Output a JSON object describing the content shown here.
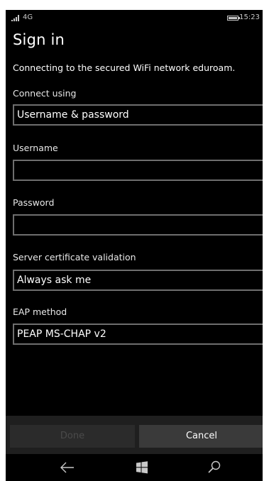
{
  "status_bar": {
    "network": "4G",
    "time": "15:23"
  },
  "page": {
    "title": "Sign in",
    "intro": "Connecting to the secured WiFi network eduroam."
  },
  "fields": {
    "connect_using": {
      "label": "Connect using",
      "value": "Username & password"
    },
    "username": {
      "label": "Username",
      "value": "",
      "placeholder": ""
    },
    "password": {
      "label": "Password",
      "value": "",
      "placeholder": ""
    },
    "server_cert": {
      "label": "Server certificate validation",
      "value": "Always ask me"
    },
    "eap_method": {
      "label": "EAP method",
      "value": "PEAP MS-CHAP v2"
    }
  },
  "app_bar": {
    "done_label": "Done",
    "cancel_label": "Cancel",
    "done_enabled": false
  },
  "nav_bar": {
    "back_icon": "back-arrow-icon",
    "start_icon": "windows-logo-icon",
    "search_icon": "search-icon"
  },
  "colors": {
    "background": "#000000",
    "text": "#ffffff",
    "field_border": "#6e6e6e",
    "app_bar": "#1f1f1f",
    "button": "#3a3a3a",
    "button_disabled_text": "#4a4a4a"
  }
}
